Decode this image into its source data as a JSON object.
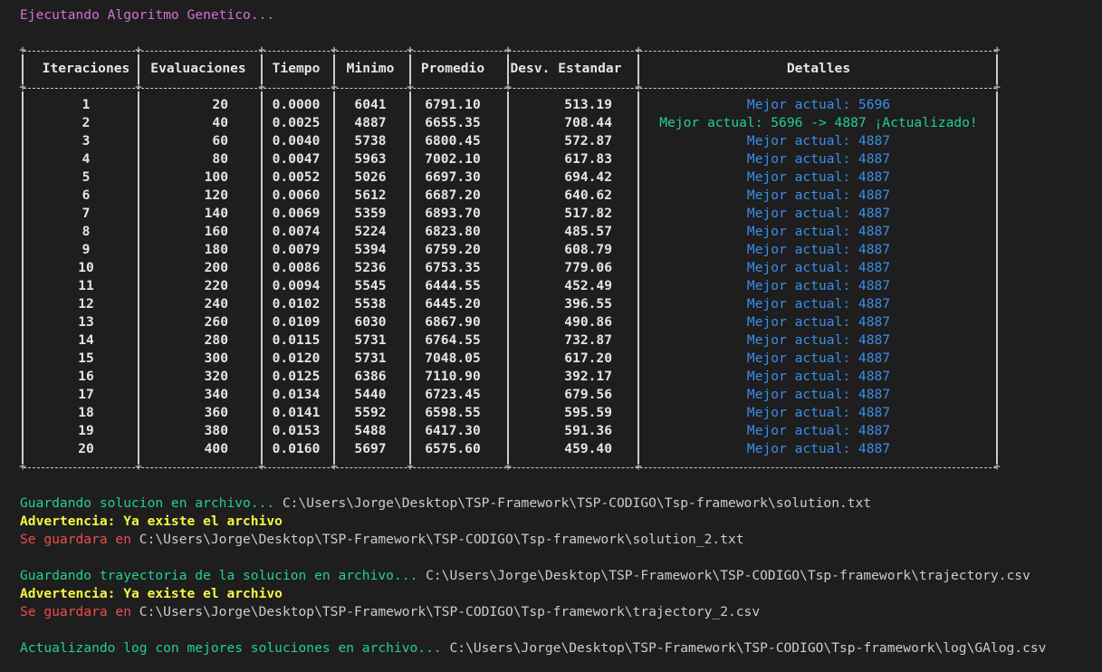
{
  "header": {
    "running_text": "Ejecutando Algoritmo Genetico..."
  },
  "table": {
    "columns": [
      "Iteraciones",
      "Evaluaciones",
      "Tiempo",
      "Minimo",
      "Promedio",
      "Desv. Estandar",
      "Detalles"
    ],
    "rows": [
      {
        "it": "1",
        "ev": "20",
        "t": "0.0000",
        "min": "6041",
        "prom": "6791.10",
        "desv": "513.19",
        "det": "Mejor actual: 5696",
        "updated": false
      },
      {
        "it": "2",
        "ev": "40",
        "t": "0.0025",
        "min": "4887",
        "prom": "6655.35",
        "desv": "708.44",
        "det": "Mejor actual: 5696 -> 4887 ¡Actualizado!",
        "updated": true
      },
      {
        "it": "3",
        "ev": "60",
        "t": "0.0040",
        "min": "5738",
        "prom": "6800.45",
        "desv": "572.87",
        "det": "Mejor actual: 4887",
        "updated": false
      },
      {
        "it": "4",
        "ev": "80",
        "t": "0.0047",
        "min": "5963",
        "prom": "7002.10",
        "desv": "617.83",
        "det": "Mejor actual: 4887",
        "updated": false
      },
      {
        "it": "5",
        "ev": "100",
        "t": "0.0052",
        "min": "5026",
        "prom": "6697.30",
        "desv": "694.42",
        "det": "Mejor actual: 4887",
        "updated": false
      },
      {
        "it": "6",
        "ev": "120",
        "t": "0.0060",
        "min": "5612",
        "prom": "6687.20",
        "desv": "640.62",
        "det": "Mejor actual: 4887",
        "updated": false
      },
      {
        "it": "7",
        "ev": "140",
        "t": "0.0069",
        "min": "5359",
        "prom": "6893.70",
        "desv": "517.82",
        "det": "Mejor actual: 4887",
        "updated": false
      },
      {
        "it": "8",
        "ev": "160",
        "t": "0.0074",
        "min": "5224",
        "prom": "6823.80",
        "desv": "485.57",
        "det": "Mejor actual: 4887",
        "updated": false
      },
      {
        "it": "9",
        "ev": "180",
        "t": "0.0079",
        "min": "5394",
        "prom": "6759.20",
        "desv": "608.79",
        "det": "Mejor actual: 4887",
        "updated": false
      },
      {
        "it": "10",
        "ev": "200",
        "t": "0.0086",
        "min": "5236",
        "prom": "6753.35",
        "desv": "779.06",
        "det": "Mejor actual: 4887",
        "updated": false
      },
      {
        "it": "11",
        "ev": "220",
        "t": "0.0094",
        "min": "5545",
        "prom": "6444.55",
        "desv": "452.49",
        "det": "Mejor actual: 4887",
        "updated": false
      },
      {
        "it": "12",
        "ev": "240",
        "t": "0.0102",
        "min": "5538",
        "prom": "6445.20",
        "desv": "396.55",
        "det": "Mejor actual: 4887",
        "updated": false
      },
      {
        "it": "13",
        "ev": "260",
        "t": "0.0109",
        "min": "6030",
        "prom": "6867.90",
        "desv": "490.86",
        "det": "Mejor actual: 4887",
        "updated": false
      },
      {
        "it": "14",
        "ev": "280",
        "t": "0.0115",
        "min": "5731",
        "prom": "6764.55",
        "desv": "732.87",
        "det": "Mejor actual: 4887",
        "updated": false
      },
      {
        "it": "15",
        "ev": "300",
        "t": "0.0120",
        "min": "5731",
        "prom": "7048.05",
        "desv": "617.20",
        "det": "Mejor actual: 4887",
        "updated": false
      },
      {
        "it": "16",
        "ev": "320",
        "t": "0.0125",
        "min": "6386",
        "prom": "7110.90",
        "desv": "392.17",
        "det": "Mejor actual: 4887",
        "updated": false
      },
      {
        "it": "17",
        "ev": "340",
        "t": "0.0134",
        "min": "5440",
        "prom": "6723.45",
        "desv": "679.56",
        "det": "Mejor actual: 4887",
        "updated": false
      },
      {
        "it": "18",
        "ev": "360",
        "t": "0.0141",
        "min": "5592",
        "prom": "6598.55",
        "desv": "595.59",
        "det": "Mejor actual: 4887",
        "updated": false
      },
      {
        "it": "19",
        "ev": "380",
        "t": "0.0153",
        "min": "5488",
        "prom": "6417.30",
        "desv": "591.36",
        "det": "Mejor actual: 4887",
        "updated": false
      },
      {
        "it": "20",
        "ev": "400",
        "t": "0.0160",
        "min": "5697",
        "prom": "6575.60",
        "desv": "459.40",
        "det": "Mejor actual: 4887",
        "updated": false
      }
    ]
  },
  "output": {
    "save_solution_msg": "Guardando solucion en archivo... ",
    "save_solution_path": "C:\\Users\\Jorge\\Desktop\\TSP-Framework\\TSP-CODIGO\\Tsp-framework\\solution.txt",
    "warning_1": "Advertencia: Ya existe el archivo",
    "save_as_1_label": "Se guardara en ",
    "save_as_1_path": "C:\\Users\\Jorge\\Desktop\\TSP-Framework\\TSP-CODIGO\\Tsp-framework\\solution_2.txt",
    "save_traj_msg": "Guardando trayectoria de la solucion en archivo... ",
    "save_traj_path": "C:\\Users\\Jorge\\Desktop\\TSP-Framework\\TSP-CODIGO\\Tsp-framework\\trajectory.csv",
    "warning_2": "Advertencia: Ya existe el archivo",
    "save_as_2_label": "Se guardara en ",
    "save_as_2_path": "C:\\Users\\Jorge\\Desktop\\TSP-Framework\\TSP-CODIGO\\Tsp-framework\\trajectory_2.csv",
    "log_msg": "Actualizando log con mejores soluciones en archivo... ",
    "log_path": "C:\\Users\\Jorge\\Desktop\\TSP-Framework\\TSP-CODIGO\\Tsp-framework\\log\\GAlog.csv"
  },
  "colors": {
    "background": "#1e1e1e",
    "magenta": "#d670d6",
    "green": "#23d18b",
    "yellow": "#f5f543",
    "red": "#f14c4c",
    "blue": "#3b8eea",
    "text": "#cccccc"
  }
}
